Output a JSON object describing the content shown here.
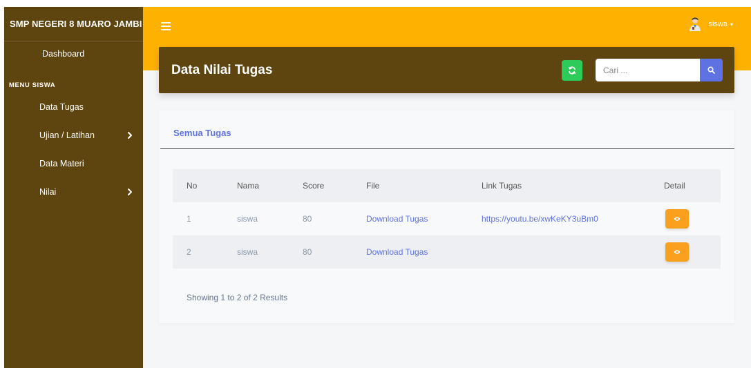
{
  "sidebar": {
    "brand": "SMP NEGERI 8 MUARO JAMBI",
    "dashboard": "Dashboard",
    "section_heading": "MENU SISWA",
    "items": [
      {
        "label": "Data Tugas",
        "has_children": false
      },
      {
        "label": "Ujian / Latihan",
        "has_children": true
      },
      {
        "label": "Data Materi",
        "has_children": false
      },
      {
        "label": "Nilai",
        "has_children": true
      }
    ]
  },
  "topbar": {
    "user_name": "siswa",
    "user_caret": "▾",
    "icons": {
      "menu": "hamburger-icon",
      "avatar": "user-avatar-icon"
    }
  },
  "header": {
    "title": "Data Nilai Tugas",
    "search_placeholder": "Cari ...",
    "icons": {
      "refresh": "refresh-icon",
      "search": "search-icon"
    }
  },
  "card": {
    "title": "Semua Tugas",
    "table": {
      "columns": [
        "No",
        "Nama",
        "Score",
        "File",
        "Link Tugas",
        "Detail"
      ],
      "rows": [
        {
          "no": "1",
          "nama": "siswa",
          "score": "80",
          "file": "Download Tugas",
          "link": "https://youtu.be/xwKeKY3uBm0"
        },
        {
          "no": "2",
          "nama": "siswa",
          "score": "80",
          "file": "Download Tugas",
          "link": ""
        }
      ]
    },
    "footer_text": "Showing 1 to 2 of 2 Results"
  },
  "colors": {
    "sidebar_bg": "#5e4510",
    "topbar_bg": "#ffb100",
    "accent": "#5e72e4",
    "refresh_button": "#2dcb5a",
    "detail_button": "#fb9f1e"
  }
}
